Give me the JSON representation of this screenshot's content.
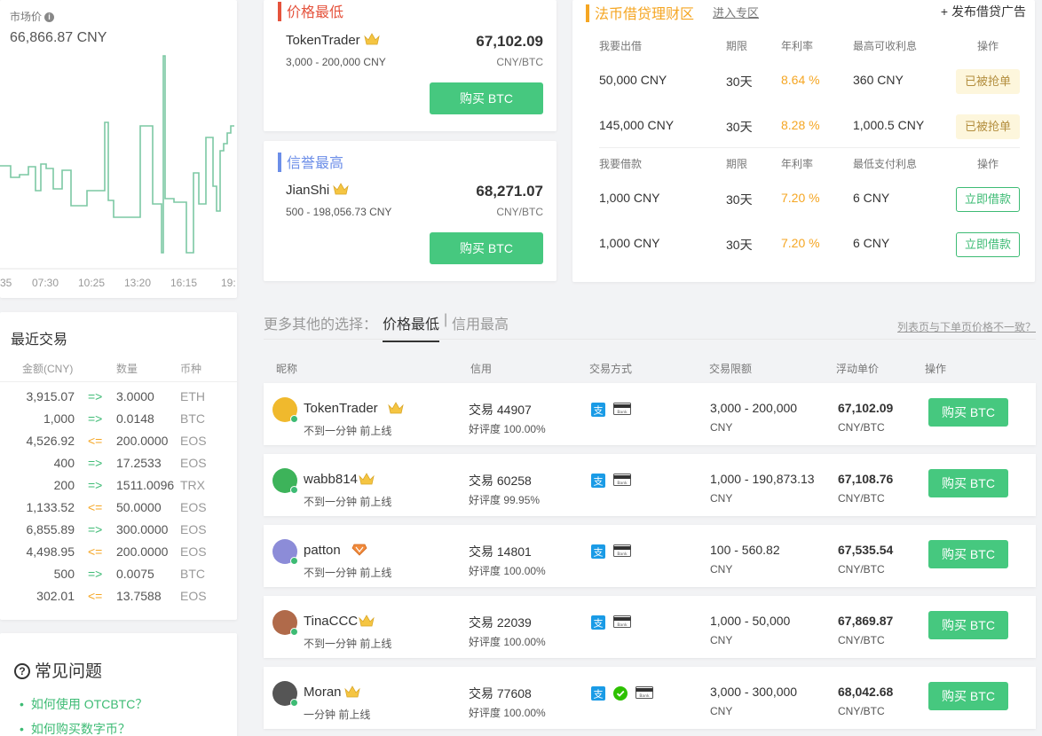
{
  "market": {
    "label": "市场价",
    "value": "66,866.87 CNY",
    "ticks": [
      "35",
      "07:30",
      "10:25",
      "13:20",
      "16:15",
      "19:"
    ]
  },
  "recent": {
    "title": "最近交易",
    "headers": [
      "金额(CNY)",
      "数量",
      "币种"
    ],
    "rows": [
      {
        "amount": "3,915.07",
        "dir": "=>",
        "qty": "3.0000",
        "coin": "ETH"
      },
      {
        "amount": "1,000",
        "dir": "=>",
        "qty": "0.0148",
        "coin": "BTC"
      },
      {
        "amount": "4,526.92",
        "dir": "<=",
        "qty": "200.0000",
        "coin": "EOS"
      },
      {
        "amount": "400",
        "dir": "=>",
        "qty": "17.2533",
        "coin": "EOS"
      },
      {
        "amount": "200",
        "dir": "=>",
        "qty": "1511.0096",
        "coin": "TRX"
      },
      {
        "amount": "1,133.52",
        "dir": "<=",
        "qty": "50.0000",
        "coin": "EOS"
      },
      {
        "amount": "6,855.89",
        "dir": "=>",
        "qty": "300.0000",
        "coin": "EOS"
      },
      {
        "amount": "4,498.95",
        "dir": "<=",
        "qty": "200.0000",
        "coin": "EOS"
      },
      {
        "amount": "500",
        "dir": "=>",
        "qty": "0.0075",
        "coin": "BTC"
      },
      {
        "amount": "302.01",
        "dir": "<=",
        "qty": "13.7588",
        "coin": "EOS"
      }
    ]
  },
  "faq": {
    "title": "常见问题",
    "items": [
      "如何使用 OTCBTC？",
      "如何购买数字币？"
    ]
  },
  "lowest": {
    "title": "价格最低",
    "name": "TokenTrader",
    "range": "3,000 - 200,000 CNY",
    "price": "67,102.09",
    "unit": "CNY/BTC",
    "button": "购买 BTC"
  },
  "credit": {
    "title": "信誉最高",
    "name": "JianShi",
    "range": "500 - 198,056.73 CNY",
    "price": "68,271.07",
    "unit": "CNY/BTC",
    "button": "购买 BTC"
  },
  "loan": {
    "title": "法币借贷理财区",
    "enter": "进入专区",
    "publish": "+ 发布借贷广告",
    "lend_headers": [
      "我要出借",
      "期限",
      "年利率",
      "最高可收利息",
      "操作"
    ],
    "lend_rows": [
      {
        "amount": "50,000 CNY",
        "term": "30天",
        "rate": "8.64 %",
        "interest": "360 CNY",
        "action": "已被抢单"
      },
      {
        "amount": "145,000 CNY",
        "term": "30天",
        "rate": "8.28 %",
        "interest": "1,000.5 CNY",
        "action": "已被抢单"
      }
    ],
    "borrow_headers": [
      "我要借款",
      "期限",
      "年利率",
      "最低支付利息",
      "操作"
    ],
    "borrow_rows": [
      {
        "amount": "1,000 CNY",
        "term": "30天",
        "rate": "7.20 %",
        "interest": "6 CNY",
        "action": "立即借款"
      },
      {
        "amount": "1,000 CNY",
        "term": "30天",
        "rate": "7.20 %",
        "interest": "6 CNY",
        "action": "立即借款"
      }
    ]
  },
  "filter": {
    "prefix": "更多其他的选择：",
    "tab_active": "价格最低",
    "separator": "|",
    "tab_other": "信用最高",
    "mismatch": "列表页与下单页价格不一致？"
  },
  "table": {
    "headers": [
      "昵称",
      "信用",
      "交易方式",
      "交易限额",
      "浮动单价",
      "操作"
    ],
    "rows": [
      {
        "name": "TokenTrader",
        "sub": "不到一分钟 前上线",
        "trades": "交易 44907",
        "rating": "好评度 100.00%",
        "limit": "3,000 - 200,000",
        "currency": "CNY",
        "price": "67,102.09",
        "unit": "CNY/BTC",
        "button": "购买 BTC",
        "avatar_color": "#f0b92d",
        "pay": [
          "alipay",
          "bank"
        ],
        "badge": "crown"
      },
      {
        "name": "wabb814",
        "sub": "不到一分钟 前上线",
        "trades": "交易 60258",
        "rating": "好评度 99.95%",
        "limit": "1,000 - 190,873.13",
        "currency": "CNY",
        "price": "67,108.76",
        "unit": "CNY/BTC",
        "button": "购买 BTC",
        "avatar_color": "#3db35a",
        "pay": [
          "alipay",
          "bank"
        ],
        "badge": "crown"
      },
      {
        "name": "patton",
        "sub": "不到一分钟 前上线",
        "trades": "交易 14801",
        "rating": "好评度 100.00%",
        "limit": "100 - 560.82",
        "currency": "CNY",
        "price": "67,535.54",
        "unit": "CNY/BTC",
        "button": "购买 BTC",
        "avatar_color": "#8c8cd8",
        "pay": [
          "alipay",
          "bank"
        ],
        "badge": "diamond"
      },
      {
        "name": "TinaCCC",
        "sub": "不到一分钟 前上线",
        "trades": "交易 22039",
        "rating": "好评度 100.00%",
        "limit": "1,000 - 50,000",
        "currency": "CNY",
        "price": "67,869.87",
        "unit": "CNY/BTC",
        "button": "购买 BTC",
        "avatar_color": "#b06a4a",
        "pay": [
          "alipay",
          "bank"
        ],
        "badge": "crown"
      },
      {
        "name": "Moran",
        "sub": "一分钟 前上线",
        "trades": "交易 77608",
        "rating": "好评度 100.00%",
        "limit": "3,000 - 300,000",
        "currency": "CNY",
        "price": "68,042.68",
        "unit": "CNY/BTC",
        "button": "购买 BTC",
        "avatar_color": "#555555",
        "pay": [
          "alipay",
          "wechat",
          "bank"
        ],
        "badge": "crown"
      }
    ]
  },
  "colors": {
    "green": "#46c87f",
    "orange": "#f5a623",
    "blue": "#6c8ee8",
    "red": "#e5533d",
    "line": "#7cc8a4"
  }
}
